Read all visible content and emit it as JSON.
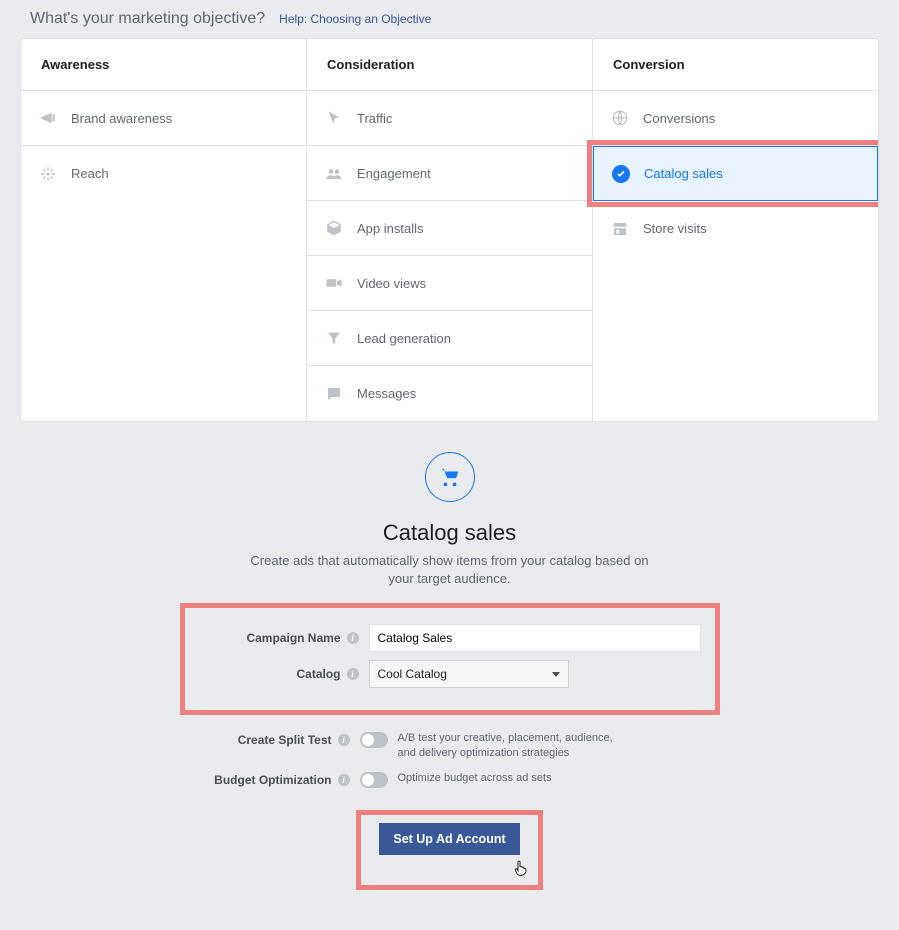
{
  "header": {
    "title": "What's your marketing objective?",
    "help_link": "Help: Choosing an Objective"
  },
  "columns": [
    {
      "header": "Awareness",
      "items": [
        {
          "label": "Brand awareness",
          "icon": "megaphone"
        },
        {
          "label": "Reach",
          "icon": "reach"
        }
      ]
    },
    {
      "header": "Consideration",
      "items": [
        {
          "label": "Traffic",
          "icon": "cursor"
        },
        {
          "label": "Engagement",
          "icon": "people"
        },
        {
          "label": "App installs",
          "icon": "box"
        },
        {
          "label": "Video views",
          "icon": "video"
        },
        {
          "label": "Lead generation",
          "icon": "funnel"
        },
        {
          "label": "Messages",
          "icon": "chat"
        }
      ]
    },
    {
      "header": "Conversion",
      "items": [
        {
          "label": "Conversions",
          "icon": "globe"
        },
        {
          "label": "Catalog sales",
          "icon": "check",
          "selected": true
        },
        {
          "label": "Store visits",
          "icon": "store"
        }
      ]
    }
  ],
  "detail": {
    "title": "Catalog sales",
    "description": "Create ads that automatically show items from your catalog based on your target audience.",
    "form": {
      "campaign_name_label": "Campaign Name",
      "campaign_name_value": "Catalog Sales",
      "catalog_label": "Catalog",
      "catalog_value": "Cool Catalog"
    },
    "options": {
      "split_test_label": "Create Split Test",
      "split_test_desc": "A/B test your creative, placement, audience, and delivery optimization strategies",
      "budget_opt_label": "Budget Optimization",
      "budget_opt_desc": "Optimize budget across ad sets"
    },
    "cta": "Set Up Ad Account"
  }
}
